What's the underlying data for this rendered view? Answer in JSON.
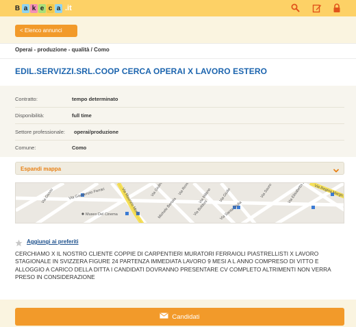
{
  "header": {
    "logo_letters": [
      "B",
      "a",
      "k",
      "e",
      "c",
      "a"
    ],
    "logo_tail": ".it",
    "icons": [
      "search-icon",
      "edit-icon",
      "lock-icon"
    ],
    "accent": "#fdd166"
  },
  "nav": {
    "back_label": "< Elenco annunci"
  },
  "breadcrumb": "Operai - produzione - qualità / Como",
  "ad": {
    "title": "EDIL.SERVIZZI.SRL.COOP CERCA OPERAI X LAVORO ESTERO",
    "details": [
      {
        "label": "Contratto:",
        "value": "tempo determinato"
      },
      {
        "label": "Disponibilità:",
        "value": "full time"
      },
      {
        "label": "Settore professionale:",
        "value": "operai/produzione"
      },
      {
        "label": "Comune:",
        "value": "Como"
      }
    ],
    "map_toggle_label": "Espandi mappa",
    "map_labels": [
      "Via Giovio",
      "Via Gaudenzio Ferrari",
      "Via Maurizio Monti",
      "Via Giulini",
      "Via Rovelli",
      "Via Milano",
      "Via Giulio",
      "Via Boldoni",
      "Via Sauro",
      "Via Elisabetta Bava",
      "Via Regina Margh.",
      "Museo Del Cinema",
      "Michele Bertola",
      "Via Santa Giulia"
    ],
    "favorites_label": "Aggiungi ai preferiti",
    "description": "CERCHIAMO X IL NOSTRO CLIENTE COPPIE DI CARPENTIERI MURATORI FERRAIOLI PIASTRELLISTI X LAVORO STAGIONALE IN SVIZZERA FIGURE 24 PARTENZA IMMEDIATA LAVORO 9 MESI A L ANNO COMPRESO DI VITTO E ALLOGGIO A CARICO DELLA DITTA I CANDIDATI DOVRANNO PRESENTARE CV COMPLETO ALTRIMENTI NON VERRA PRESO IN CONSIDERAZIONE",
    "apply_label": "Candidati"
  }
}
